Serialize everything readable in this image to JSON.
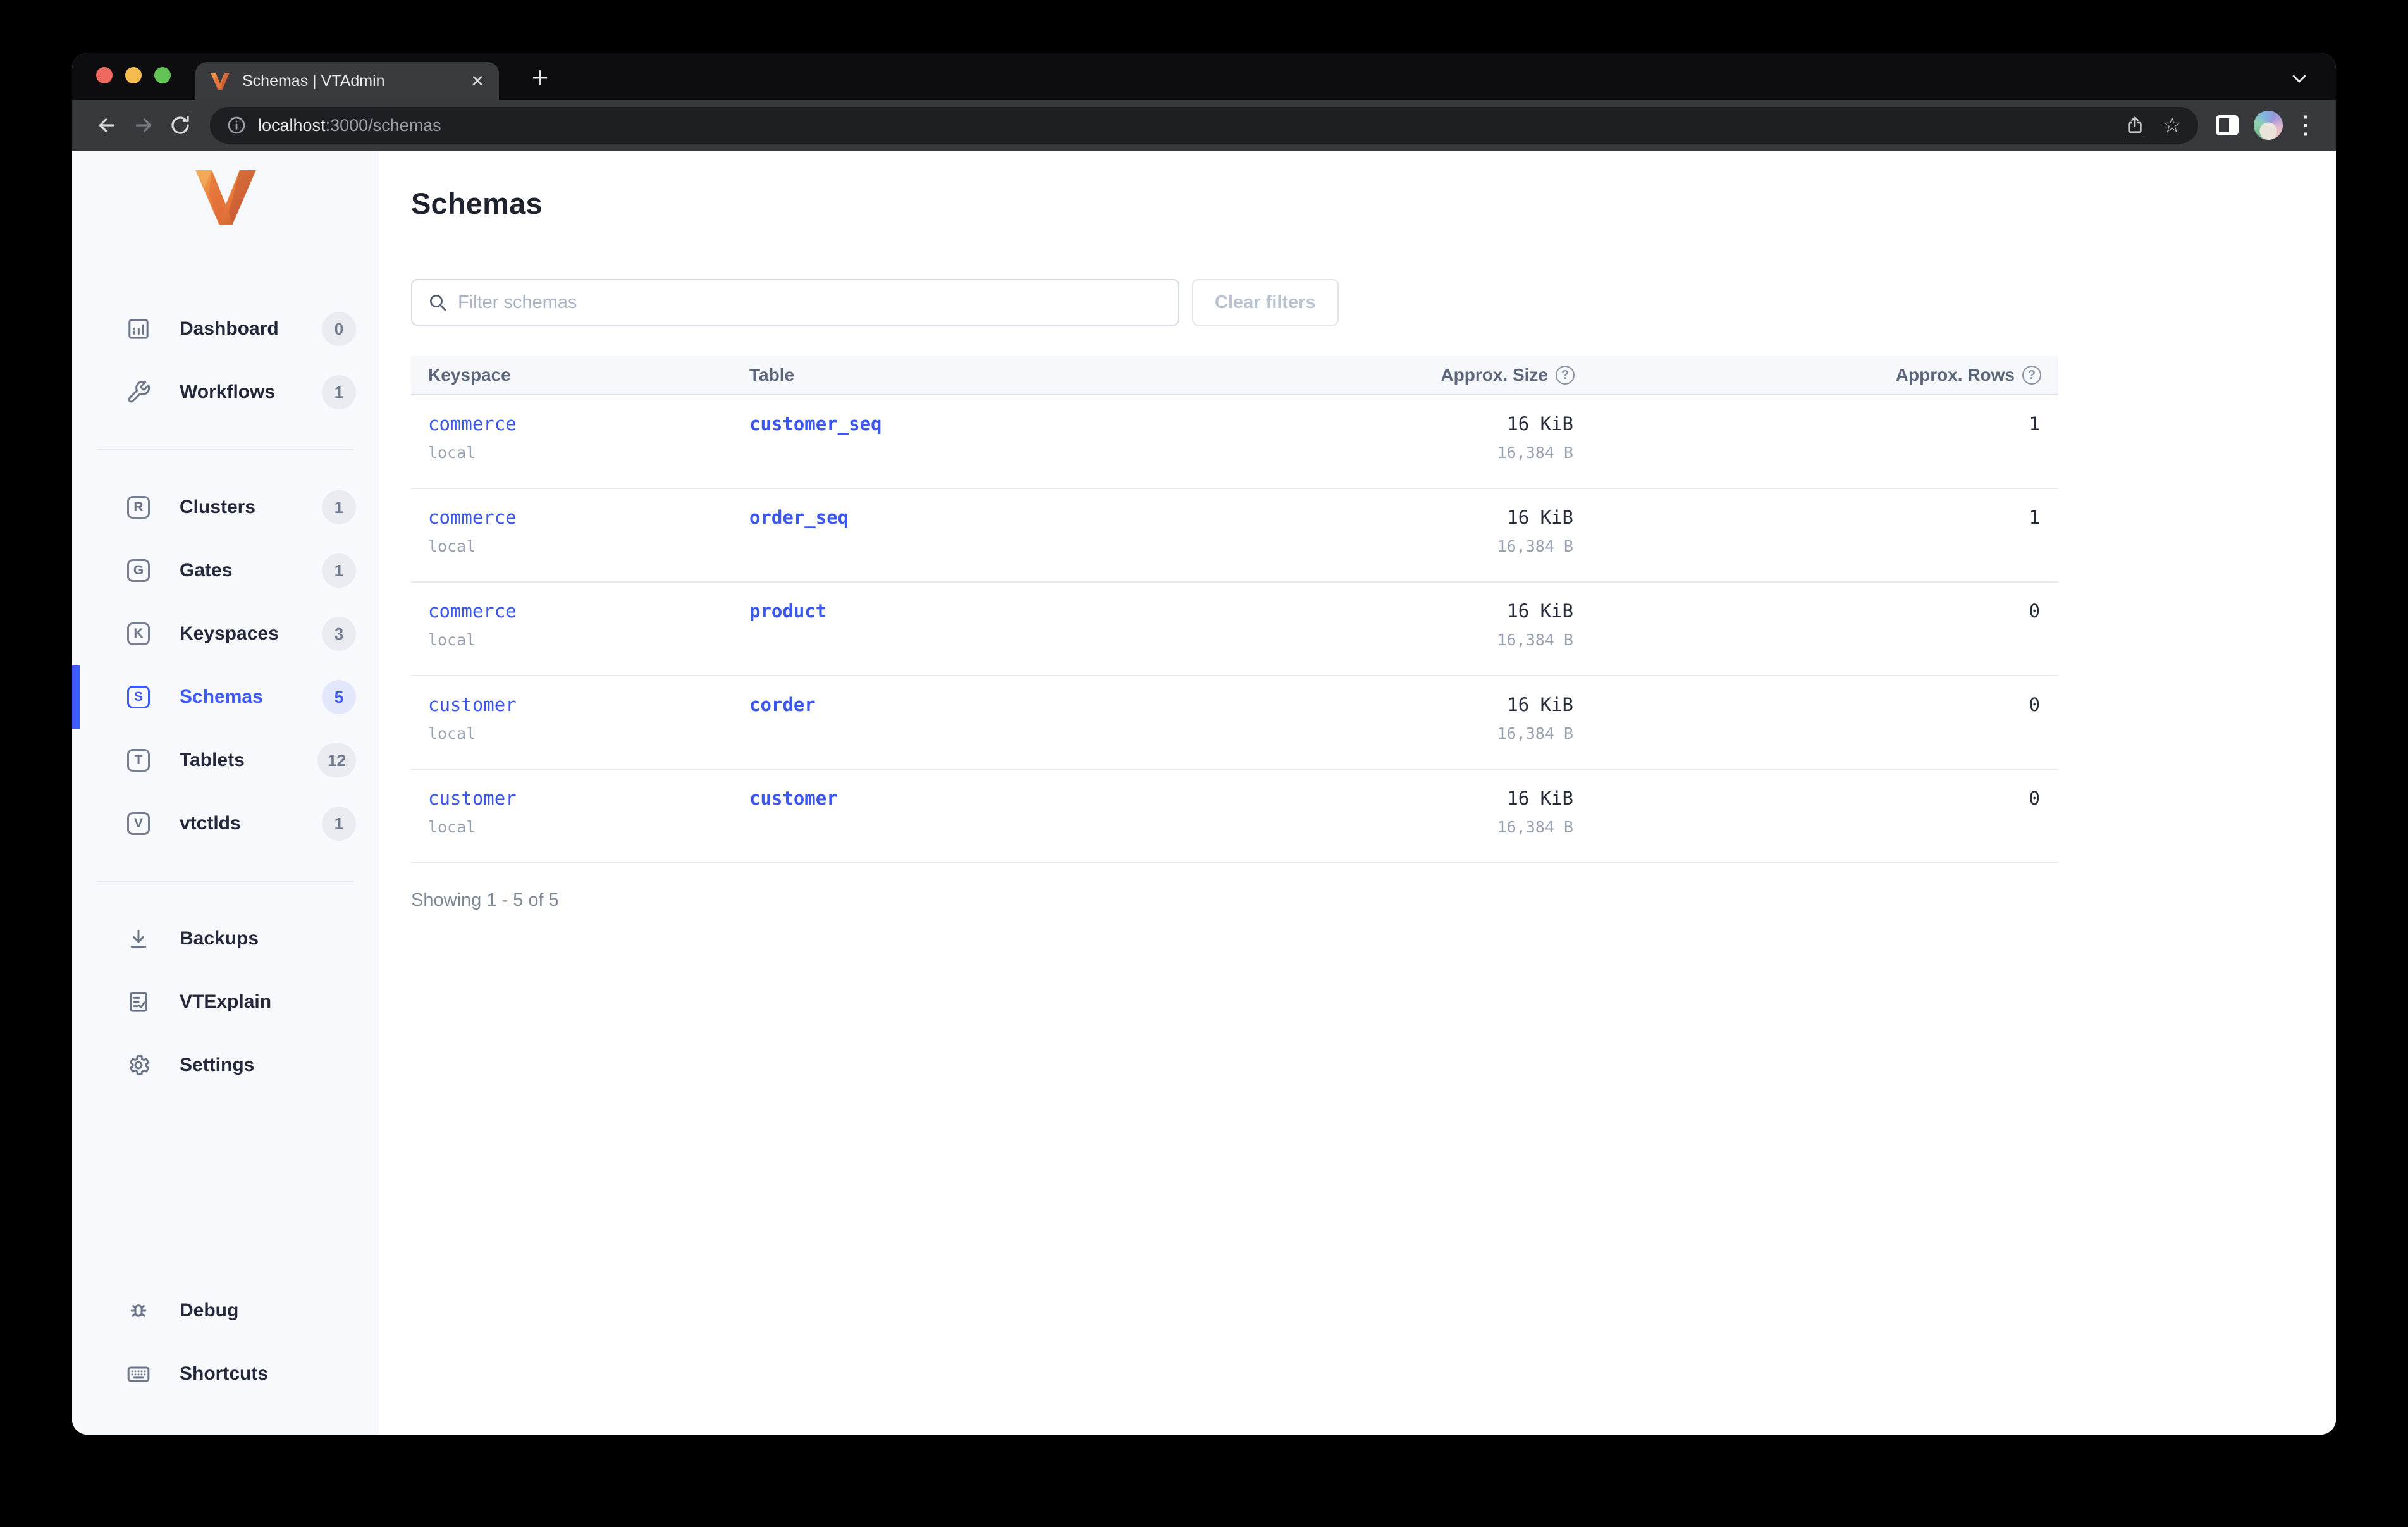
{
  "colors": {
    "accent": "#3d5afe",
    "link_blue": "#3b57f0",
    "traffic_red": "#ee6a5f",
    "traffic_yellow": "#f5bd4f",
    "traffic_green": "#61c454"
  },
  "browser": {
    "tab_title": "Schemas | VTAdmin",
    "close_glyph": "×",
    "newtab_glyph": "+",
    "url_host": "localhost",
    "url_path": ":3000/schemas",
    "menu_glyph": "⋮",
    "star_glyph": "☆"
  },
  "sidebar": {
    "groups": [
      {
        "items": [
          {
            "label": "Dashboard",
            "badge": "0",
            "icon": "dashboard"
          },
          {
            "label": "Workflows",
            "badge": "1",
            "icon": "wrench"
          }
        ]
      },
      {
        "items": [
          {
            "label": "Clusters",
            "badge": "1",
            "letter": "R"
          },
          {
            "label": "Gates",
            "badge": "1",
            "letter": "G"
          },
          {
            "label": "Keyspaces",
            "badge": "3",
            "letter": "K"
          },
          {
            "label": "Schemas",
            "badge": "5",
            "letter": "S",
            "selected": true
          },
          {
            "label": "Tablets",
            "badge": "12",
            "letter": "T"
          },
          {
            "label": "vtctlds",
            "badge": "1",
            "letter": "V"
          }
        ]
      },
      {
        "items": [
          {
            "label": "Backups",
            "icon": "download"
          },
          {
            "label": "VTExplain",
            "icon": "clipboard"
          },
          {
            "label": "Settings",
            "icon": "gear"
          }
        ]
      }
    ],
    "bottom_items": [
      {
        "label": "Debug",
        "icon": "bug"
      },
      {
        "label": "Shortcuts",
        "icon": "keyboard"
      }
    ]
  },
  "main": {
    "title": "Schemas",
    "filter_placeholder": "Filter schemas",
    "clear_button": "Clear filters",
    "table": {
      "columns": [
        "Keyspace",
        "Table",
        "Approx. Size",
        "Approx. Rows"
      ],
      "help_glyph": "?",
      "rows": [
        {
          "keyspace": "commerce",
          "cluster": "local",
          "table": "customer_seq",
          "size": "16 KiB",
          "size_bytes": "16,384 B",
          "rows": "1"
        },
        {
          "keyspace": "commerce",
          "cluster": "local",
          "table": "order_seq",
          "size": "16 KiB",
          "size_bytes": "16,384 B",
          "rows": "1"
        },
        {
          "keyspace": "commerce",
          "cluster": "local",
          "table": "product",
          "size": "16 KiB",
          "size_bytes": "16,384 B",
          "rows": "0"
        },
        {
          "keyspace": "customer",
          "cluster": "local",
          "table": "corder",
          "size": "16 KiB",
          "size_bytes": "16,384 B",
          "rows": "0"
        },
        {
          "keyspace": "customer",
          "cluster": "local",
          "table": "customer",
          "size": "16 KiB",
          "size_bytes": "16,384 B",
          "rows": "0"
        }
      ]
    },
    "footer": "Showing 1 - 5 of 5"
  }
}
